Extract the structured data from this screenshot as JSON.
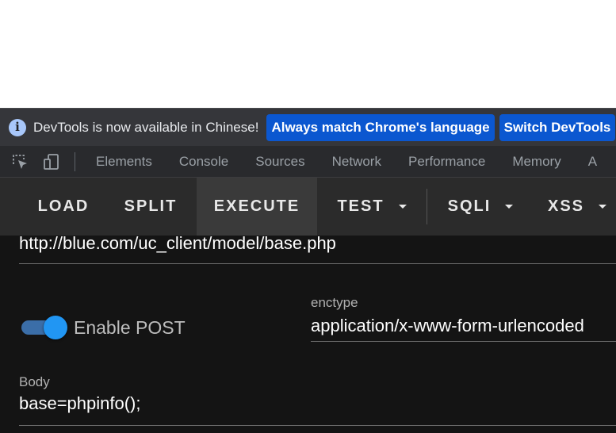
{
  "infobar": {
    "icon": "info-icon",
    "message": "DevTools is now available in Chinese!",
    "match_button": "Always match Chrome's language",
    "switch_button": "Switch DevTools"
  },
  "devtools_tabs": {
    "icons": [
      "inspect-element-icon",
      "device-toolbar-icon"
    ],
    "items": [
      "Elements",
      "Console",
      "Sources",
      "Network",
      "Performance",
      "Memory",
      "A"
    ]
  },
  "hackbar": {
    "buttons": {
      "load": "LOAD",
      "split": "SPLIT",
      "execute": "EXECUTE",
      "test": "TEST",
      "sqli": "SQLI",
      "xss": "XSS"
    },
    "active_button": "EXECUTE",
    "url": "http://blue.com/uc_client/model/base.php",
    "enable_post": {
      "label": "Enable POST",
      "checked": true
    },
    "enctype": {
      "label": "enctype",
      "value": "application/x-www-form-urlencoded"
    },
    "body": {
      "label": "Body",
      "value": "base=phpinfo();"
    }
  },
  "colors": {
    "accent_blue": "#0b57d0",
    "toggle_on": "#2196f3",
    "panel_bg": "#141414",
    "toolbar_bg": "#2b2b2b"
  }
}
